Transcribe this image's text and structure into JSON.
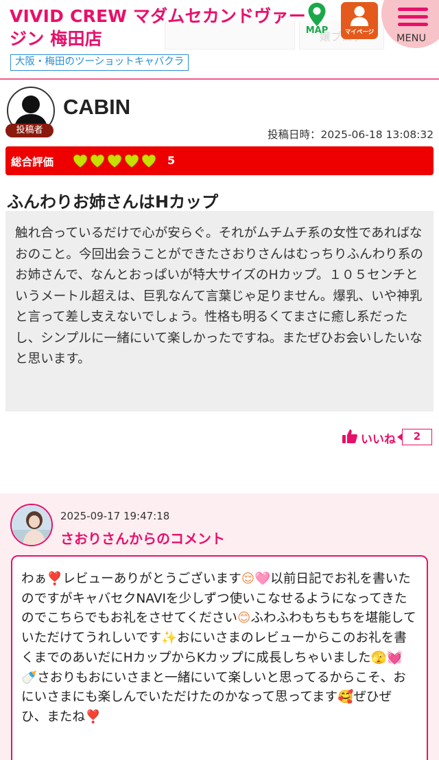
{
  "header": {
    "shop_name": "VIVID CREW マダムセカンドヴァージン 梅田店",
    "shop_tagline": "大阪・梅田のツーショットキャバクラ",
    "bg_tab_2": "嬢ブログ",
    "map_label": "MAP",
    "mypage_label": "マイページ",
    "menu_label": "MENU"
  },
  "review": {
    "poster_badge": "投稿者",
    "poster_name": "CABIN",
    "post_date": "投稿日時：2025-06-18 13:08:32",
    "rating_label": "総合評価",
    "rating_value": "5",
    "rating_hearts": 5,
    "heart_color": "#c8e000",
    "title": "ふんわりお姉さんはHカップ",
    "body": "触れ合っているだけで心が安らぐ。それがムチムチ系の女性であればなおのこと。今回出会うことができたさおりさんはむっちりふんわり系のお姉さんで、なんとおっぱいが特大サイズのHカップ。１０５センチというメートル超えは、巨乳なんて言葉じゃ足りません。爆乳、いや神乳と言って差し支えないでしょう。性格も明るくてまさに癒し系だったし、シンプルに一緒にいて楽しかったですね。またぜひお会いしたいなと思います。",
    "like_label": "いいね",
    "like_count": "2"
  },
  "comment": {
    "date": "2025-09-17 19:47:18",
    "title": "さおりさんからのコメント",
    "body_parts": [
      "わぁ",
      "❣️",
      "レビューありがとうございます",
      "😌🩷",
      "以前日記でお礼を書いたのですがキャバセクNAVIを少しずつ使いこなせるようになってきたのでこちらでもお礼をさせてください",
      "😊",
      "ふわふわもちもちを堪能していただけてうれしいです",
      "✨",
      "おにいさまのレビューからこのお礼を書くまでのあいだにHカップからKカップに成長しちゃいました",
      "🫣💓🍼",
      "さおりもおにいさまと一緒にいて楽しいと思ってるからこそ、おにいさまにも楽しんでいただけたのかなって思ってます",
      "🥰",
      "ぜひぜひ、またね",
      "❣️"
    ]
  },
  "colors": {
    "brand_pink": "#e8106b",
    "rating_red": "#ee0000",
    "tag_blue": "#2a8fd6",
    "map_green": "#1aa84a",
    "mypage_orange": "#e35a1c",
    "menu_circle": "#f8c3c8",
    "comment_bg": "#fdeef1"
  },
  "icons": {
    "map": "map-pin-icon",
    "mypage": "user-icon",
    "menu": "hamburger-icon",
    "like": "thumbs-up-icon",
    "rating": "heart-icon"
  }
}
